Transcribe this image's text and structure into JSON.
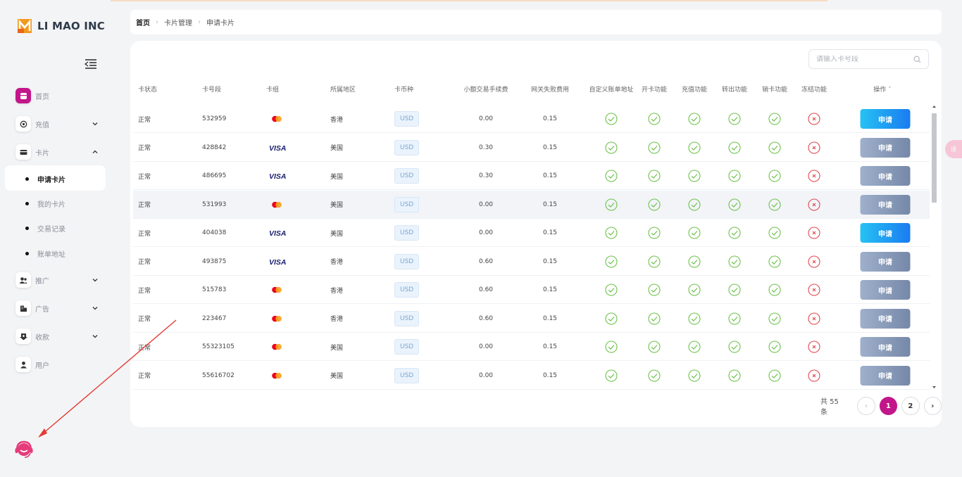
{
  "brand": {
    "name": "LI MAO INC",
    "accent": "#c2168a"
  },
  "sidebar": {
    "items": [
      {
        "label": "首页",
        "icon": "home-icon"
      },
      {
        "label": "充值",
        "icon": "recharge-icon"
      },
      {
        "label": "卡片",
        "icon": "card-icon"
      },
      {
        "label": "推广",
        "icon": "users-icon"
      },
      {
        "label": "广告",
        "icon": "building-icon"
      },
      {
        "label": "收款",
        "icon": "download-icon"
      },
      {
        "label": "用户",
        "icon": "user-icon"
      }
    ],
    "card_subitems": [
      "申请卡片",
      "我的卡片",
      "交易记录",
      "账单地址"
    ]
  },
  "breadcrumb": [
    "首页",
    "卡片管理",
    "申请卡片"
  ],
  "search": {
    "placeholder": "请输入卡号段"
  },
  "table": {
    "headers": [
      "卡状态",
      "卡号段",
      "卡组",
      "所属地区",
      "卡币种",
      "小额交易手续费",
      "网关失败费用",
      "自定义账单地址",
      "开卡功能",
      "充值功能",
      "转出功能",
      "销卡功能",
      "冻结功能",
      "操作"
    ],
    "rows": [
      {
        "status": "正常",
        "number": "532959",
        "brand": "mastercard",
        "region": "香港",
        "currency": "USD",
        "small_fee": "0.00",
        "gateway_fee": "0.15",
        "btn": "申请",
        "btn_style": "blue"
      },
      {
        "status": "正常",
        "number": "428842",
        "brand": "visa",
        "region": "美国",
        "currency": "USD",
        "small_fee": "0.30",
        "gateway_fee": "0.15",
        "btn": "申请",
        "btn_style": "gray"
      },
      {
        "status": "正常",
        "number": "486695",
        "brand": "visa",
        "region": "美国",
        "currency": "USD",
        "small_fee": "0.30",
        "gateway_fee": "0.15",
        "btn": "申请",
        "btn_style": "gray"
      },
      {
        "status": "正常",
        "number": "531993",
        "brand": "mastercard",
        "region": "美国",
        "currency": "USD",
        "small_fee": "0.00",
        "gateway_fee": "0.15",
        "btn": "申请",
        "btn_style": "gray"
      },
      {
        "status": "正常",
        "number": "404038",
        "brand": "visa",
        "region": "美国",
        "currency": "USD",
        "small_fee": "0.00",
        "gateway_fee": "0.15",
        "btn": "申请",
        "btn_style": "blue"
      },
      {
        "status": "正常",
        "number": "493875",
        "brand": "visa",
        "region": "香港",
        "currency": "USD",
        "small_fee": "0.60",
        "gateway_fee": "0.15",
        "btn": "申请",
        "btn_style": "gray"
      },
      {
        "status": "正常",
        "number": "515783",
        "brand": "mastercard",
        "region": "香港",
        "currency": "USD",
        "small_fee": "0.60",
        "gateway_fee": "0.15",
        "btn": "申请",
        "btn_style": "gray"
      },
      {
        "status": "正常",
        "number": "223467",
        "brand": "mastercard",
        "region": "香港",
        "currency": "USD",
        "small_fee": "0.60",
        "gateway_fee": "0.15",
        "btn": "申请",
        "btn_style": "gray"
      },
      {
        "status": "正常",
        "number": "55323105",
        "brand": "mastercard",
        "region": "美国",
        "currency": "USD",
        "small_fee": "0.00",
        "gateway_fee": "0.15",
        "btn": "申请",
        "btn_style": "gray"
      },
      {
        "status": "正常",
        "number": "55616702",
        "brand": "mastercard",
        "region": "美国",
        "currency": "USD",
        "small_fee": "0.00",
        "gateway_fee": "0.15",
        "btn": "申请",
        "btn_style": "gray"
      }
    ]
  },
  "pagination": {
    "total": "共 55 条",
    "pages": [
      "1",
      "2"
    ],
    "current": "1"
  },
  "side_tab": {
    "label": "译"
  }
}
